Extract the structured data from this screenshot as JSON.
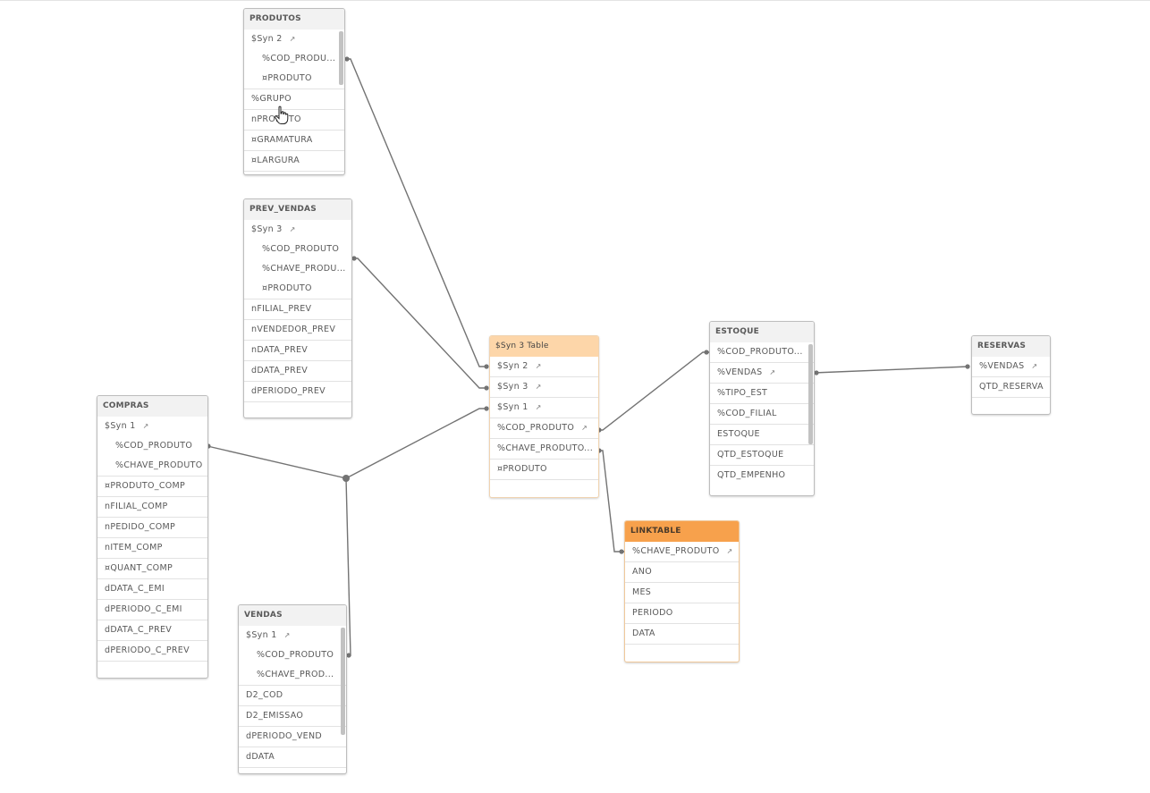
{
  "tables": {
    "produtos": {
      "title": "PRODUTOS",
      "synthetic_key": "$Syn 2",
      "synthetic_fields": [
        "%COD_PRODU...",
        "¤PRODUTO"
      ],
      "fields": [
        "%GRUPO",
        "nPRODUTO",
        "¤GRAMATURA",
        "¤LARGURA"
      ]
    },
    "prev_vendas": {
      "title": "PREV_VENDAS",
      "synthetic_key": "$Syn 3",
      "synthetic_fields": [
        "%COD_PRODUTO",
        "%CHAVE_PRODU...",
        "¤PRODUTO"
      ],
      "fields": [
        "nFILIAL_PREV",
        "nVENDEDOR_PREV",
        "nDATA_PREV",
        "dDATA_PREV",
        "dPERIODO_PREV"
      ]
    },
    "compras": {
      "title": "COMPRAS",
      "synthetic_key": "$Syn 1",
      "synthetic_fields": [
        "%COD_PRODUTO",
        "%CHAVE_PRODUTO"
      ],
      "fields": [
        "¤PRODUTO_COMP",
        "nFILIAL_COMP",
        "nPEDIDO_COMP",
        "nITEM_COMP",
        "¤QUANT_COMP",
        "dDATA_C_EMI",
        "dPERIODO_C_EMI",
        "dDATA_C_PREV",
        "dPERIODO_C_PREV"
      ]
    },
    "vendas": {
      "title": "VENDAS",
      "synthetic_key": "$Syn 1",
      "synthetic_fields": [
        "%COD_PRODUTO",
        "%CHAVE_PROD..."
      ],
      "fields": [
        "D2_COD",
        "D2_EMISSAO",
        "dPERIODO_VEND",
        "dDATA"
      ]
    },
    "syn3": {
      "title": "$Syn 3 Table",
      "key_fields": [
        "$Syn 2",
        "$Syn 3",
        "$Syn 1",
        "%COD_PRODUTO"
      ],
      "fields": [
        "%CHAVE_PRODUTO...",
        "¤PRODUTO"
      ]
    },
    "estoque": {
      "title": "ESTOQUE",
      "key_fields": [
        "%VENDAS"
      ],
      "fields": [
        "%COD_PRODUTO...",
        "%TIPO_EST",
        "%COD_FILIAL",
        "ESTOQUE",
        "QTD_ESTOQUE",
        "QTD_EMPENHO"
      ]
    },
    "reservas": {
      "title": "RESERVAS",
      "key_fields": [
        "%VENDAS"
      ],
      "fields": [
        "QTD_RESERVA"
      ]
    },
    "linktable": {
      "title": "LINKTABLE",
      "key_fields": [
        "%CHAVE_PRODUTO"
      ],
      "fields": [
        "ANO",
        "MES",
        "PERIODO",
        "DATA"
      ]
    }
  },
  "icons": {
    "key": "↗",
    "cursor": "hand-pointer"
  },
  "colors": {
    "synthetic_header": "#fdd6a9",
    "link_header": "#f7a14c",
    "default_header": "#f2f2f2",
    "connector": "#6e6e6e"
  }
}
